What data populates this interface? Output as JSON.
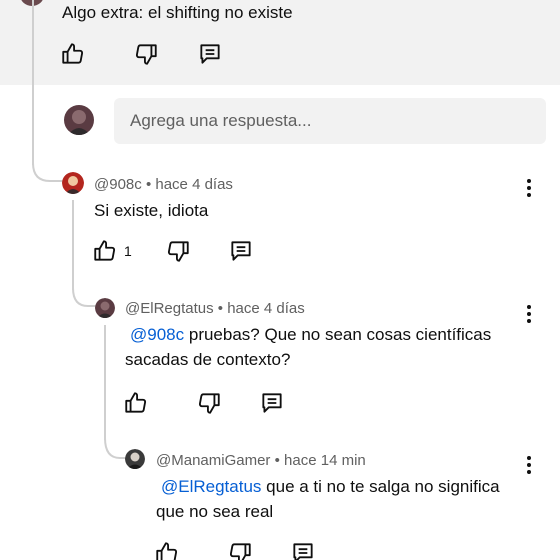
{
  "top_comment": {
    "text": "Algo extra: el shifting no existe"
  },
  "reply_box": {
    "placeholder": "Agrega una respuesta..."
  },
  "replies": [
    {
      "handle": "@908c",
      "time": "hace 4 días",
      "mention": "",
      "text": "Si existe, idiota",
      "likes": "1",
      "avatar_color": "#b3261e"
    },
    {
      "handle": "@ElRegtatus",
      "time": "hace 4 días",
      "mention": "@908c",
      "text": "pruebas? Que no sean cosas científicas",
      "text_line2": "sacadas de contexto?",
      "likes": "",
      "avatar_color": "#5a3b42"
    },
    {
      "handle": "@ManamiGamer",
      "time": "hace 14 min",
      "mention": "@ElRegtatus",
      "text": "que a ti no te salga no significa",
      "text_line2": "que no sea real",
      "likes": "",
      "avatar_color": "#3a3a3a"
    }
  ],
  "separator": "•"
}
